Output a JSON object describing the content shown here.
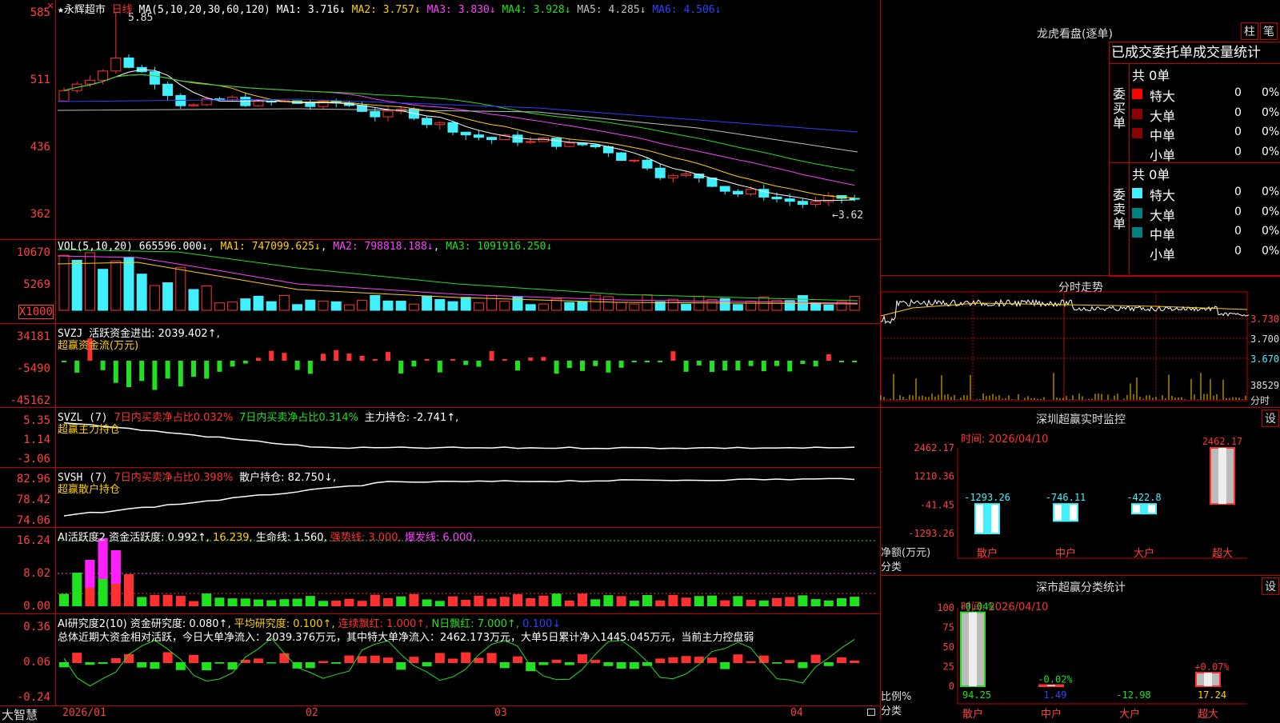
{
  "colors": {
    "up": "#ff3030",
    "down": "#40f0ff",
    "green": "#20e020",
    "axis": "#ff4040",
    "border": "#c00000",
    "ma1": "#ffffff",
    "ma2": "#ffd000",
    "ma3": "#ff40ff",
    "ma4": "#20e020",
    "ma5": "#c0c0c0",
    "ma6": "#3040ff"
  },
  "main": {
    "star": "★",
    "stock_name": "永辉超市",
    "period": "日线",
    "ma_label": "MA(5,10,20,30,60,120)",
    "ma1_label": "MA1: 3.716↓",
    "ma2_label": "MA2: 3.757↓",
    "ma3_label": "MA3: 3.830↓",
    "ma4_label": "MA4: 3.928↓",
    "ma5_label": "MA5: 4.285↓",
    "ma6_label": "MA6: 4.506↓",
    "high_mark": "5.85",
    "low_mark": "←3.62",
    "axis": [
      "585",
      "511",
      "436",
      "362"
    ]
  },
  "vol": {
    "label": "VOL(5,10,20)",
    "value": "665596.000↓",
    "ma1": "MA1: 747099.625↓",
    "ma2": "MA2: 798818.188↓",
    "ma3": "MA3: 1091916.250↓",
    "axis": [
      "10670",
      "5269"
    ],
    "unit": "X1000"
  },
  "svzj": {
    "label": "SVZJ",
    "desc": "活跃资金进出: 2039.402↑,",
    "sub": "超赢资金流(万元)",
    "axis": [
      "34181",
      "-5490",
      "-45162"
    ]
  },
  "svzl": {
    "label": "SVZL (7)",
    "p1": "7日内买卖净占比0.032%",
    "p2": "7日内买卖净占比0.314%",
    "p3": "主力持仓: -2.741↑,",
    "sub": "超赢主力持仓",
    "axis": [
      "5.35",
      "1.14",
      "-3.06"
    ]
  },
  "svsh": {
    "label": "SVSH (7)",
    "p1": "7日内买卖净占比0.398%",
    "p2": "散户持仓: 82.750↓,",
    "sub": "超赢散户持仓",
    "axis": [
      "82.96",
      "78.42",
      "74.06"
    ]
  },
  "ai1": {
    "label": "AI活跃度2",
    "p1": "资金活跃度: 0.992↑,",
    "p2": "16.239,",
    "p3": "生命线: 1.560,",
    "p4": "强势线: 3.000,",
    "p5": "爆发线: 6.000,",
    "axis": [
      "16.24",
      "8.02",
      "0.00"
    ]
  },
  "ai2": {
    "label": "AI研究度2(10)",
    "p1": "资金研究度: 0.080↑,",
    "p2": "平均研究度: 0.100↑,",
    "p3": "连续飘红: 1.000↑,",
    "p4": "N日飘红: 7.000↑,",
    "p5": "0.100↓",
    "summary": "总体近期大资金相对活跃，今日大单净流入：2039.376万元，其中特大单净流入：2462.173万元，大单5日累计净入1445.045万元，当前主力控盘弱",
    "axis": [
      "0.36",
      "0.06",
      "-0.24"
    ]
  },
  "time_axis": {
    "brand": "大智慧",
    "labels": [
      "2026/01",
      "02",
      "03",
      "04"
    ]
  },
  "longhu": {
    "title": "龙虎看盘(逐单)",
    "btn1": "柱",
    "btn2": "笔",
    "header": "已成交委托单成交量统计",
    "buy": {
      "side": "委买单",
      "total": "共 0单",
      "rows": [
        {
          "name": "特大",
          "n": "0",
          "p": "0%"
        },
        {
          "name": "大单",
          "n": "0",
          "p": "0%"
        },
        {
          "name": "中单",
          "n": "0",
          "p": "0%"
        },
        {
          "name": "小单",
          "n": "0",
          "p": "0%"
        }
      ]
    },
    "sell": {
      "side": "委卖单",
      "total": "共 0单",
      "rows": [
        {
          "name": "特大",
          "n": "0",
          "p": "0%"
        },
        {
          "name": "大单",
          "n": "0",
          "p": "0%"
        },
        {
          "name": "中单",
          "n": "0",
          "p": "0%"
        },
        {
          "name": "小单",
          "n": "0",
          "p": "0%"
        }
      ]
    }
  },
  "fenshi": {
    "title": "分时走势",
    "prices": [
      "3.730",
      "3.700",
      "3.670"
    ],
    "vol": "38529",
    "unit": "分时"
  },
  "monitor": {
    "title": "深圳超赢实时监控",
    "btn": "设",
    "date": "时间: 2026/04/10",
    "axis": [
      "2462.17",
      "1210.36",
      "-41.45",
      "-1293.26"
    ],
    "ylabel": "净额(万元)",
    "xlabel": "分类",
    "categories": [
      "散户",
      "中户",
      "大户",
      "超大"
    ],
    "values": [
      "-1293.26",
      "-746.11",
      "-422.8",
      "2462.17"
    ],
    "chart_data": {
      "type": "bar",
      "categories": [
        "散户",
        "中户",
        "大户",
        "超大"
      ],
      "values": [
        -1293.26,
        -746.11,
        -422.8,
        2462.17
      ],
      "ylim": [
        -1293.26,
        2462.17
      ]
    }
  },
  "classify": {
    "title": "深市超赢分类统计",
    "btn": "设",
    "date": "时间: 2026/04/10",
    "axis": [
      "100",
      "75",
      "50",
      "25",
      "0"
    ],
    "ylabel": "比例%",
    "xlabel": "分类",
    "categories": [
      "散户",
      "中户",
      "大户",
      "超大"
    ],
    "top": [
      "-0.04%",
      "-0.02%",
      "",
      "+0.07%"
    ],
    "bottom": [
      "94.25",
      "1.49",
      "-12.98",
      "17.24"
    ],
    "chart_data": {
      "type": "bar",
      "categories": [
        "散户",
        "中户",
        "大户",
        "超大"
      ],
      "values": [
        94.25,
        1.49,
        -12.98,
        17.24
      ],
      "ylim": [
        0,
        100
      ]
    }
  }
}
